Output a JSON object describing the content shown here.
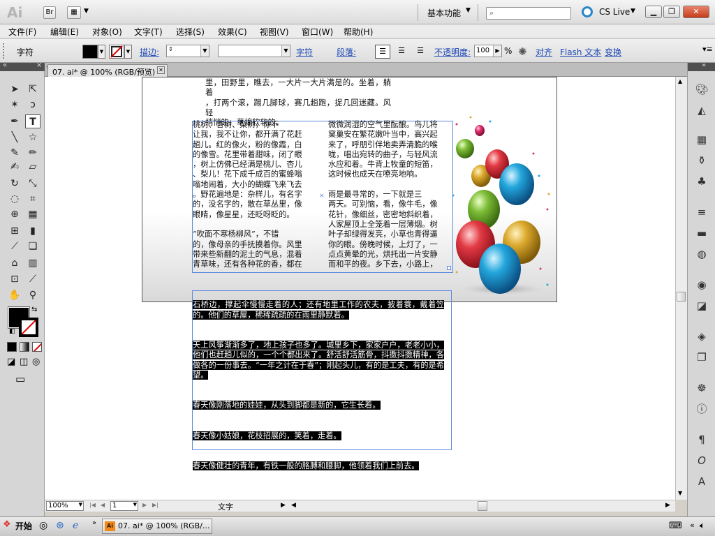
{
  "titlebar": {
    "app_logo": "Ai",
    "bridge_label": "Br",
    "workspace": "基本功能",
    "cs_live": "CS Live",
    "min": "▁",
    "max": "❐",
    "close": "✕"
  },
  "menubar": {
    "items": [
      "文件(F)",
      "编辑(E)",
      "对象(O)",
      "文字(T)",
      "选择(S)",
      "效果(C)",
      "视图(V)",
      "窗口(W)",
      "帮助(H)"
    ]
  },
  "controlbar": {
    "label": "字符",
    "stroke_label": "描边:",
    "char_link": "字符",
    "para_link": "段落:",
    "opacity_link": "不透明度:",
    "opacity_value": "100",
    "opacity_unit": "%",
    "align_link": "对齐",
    "flash_link": "Flash 文本",
    "transform_link": "变换"
  },
  "document": {
    "tab_title": "07. ai* @ 100% (RGB/预览)"
  },
  "text": {
    "top_intro": "里，田野里，瞧去，一大片一大片满是的。坐着，躺着\n，打两个滚，踢几脚球，赛几趟跑，捉几回迷藏。风轻\n悄悄的，草绵软软的。",
    "col1": "      桃树、杏树、梨树，你不\n让我，我不让你，都开满了花赶\n趟儿。红的像火，粉的像霞，白\n的像雪。花里带着甜味，闭了眼\n，树上仿佛已经满是桃儿、杏儿\n、梨儿！花下成千成百的蜜蜂嗡\n嗡地闹着，大小的蝴蝶飞来飞去\n。野花遍地是：杂样儿，有名字\n的，没名字的，散在草丛里，像\n眼睛，像星星，还眨呀眨的。\n\n      “吹面不寒杨柳风”，不错\n的，像母亲的手抚摸着你。风里\n带来些新翻的泥土的气息，混着\n青草味，还有各种花的香，都在",
    "col2": "微微润湿的空气里酝酿。鸟儿将\n窠巢安在繁花嫩叶当中，高兴起\n来了，呼朋引伴地卖弄清脆的喉\n咙，唱出宛转的曲子，与轻风流\n水应和着。牛背上牧童的短笛，\n这时候也成天在嘹亮地响。\n\n      雨是最寻常的，一下就是三\n两天。可别恼，看，像牛毛，像\n花针，像细丝，密密地斜织着，\n人家屋顶上全笼着一层薄烟。树\n叶子却绿得发亮，小草也青得逼\n你的眼。傍晚时候，上灯了，一\n点点黄晕的光，烘托出一片安静\n而和平的夜。乡下去，小路上，",
    "sel_p1": "石桥边，撑起伞慢慢走着的人；还有地里工作的农夫，披着蓑，戴着笠的。他们的草屋，稀稀疏疏的在雨里静默着。",
    "sel_p2": "      天上风筝渐渐多了，地上孩子也多了。城里乡下，家家户户，老老小小，他们也赶趟儿似的，一个个都出来了。舒活舒活筋骨，抖擞抖擞精神，各做各的一份事去。“一年之计在于春”；刚起头儿，有的是工夫，有的是希望。",
    "sel_p3": "      春天像刚落地的娃娃，从头到脚都是新的，它生长着。",
    "sel_p4": "      春天像小姑娘，花枝招展的，笑着，走着。",
    "sel_p5": "      春天像健壮的青年，有铁一般的胳膊和腰脚，他领着我们上前去。"
  },
  "statusbar": {
    "zoom": "100%",
    "page": "1",
    "tool_status": "文字"
  },
  "taskbar": {
    "start": "开始",
    "task_item": "07. ai* @ 100% (RGB/..."
  },
  "colors": {
    "selection_frame": "#5d89e0",
    "link": "#1a46b5",
    "egg_red": "#d8303c",
    "egg_blue": "#1e9fd4",
    "egg_green": "#7ab534",
    "egg_gold": "#d9a62b",
    "egg_pink": "#e0316e"
  }
}
